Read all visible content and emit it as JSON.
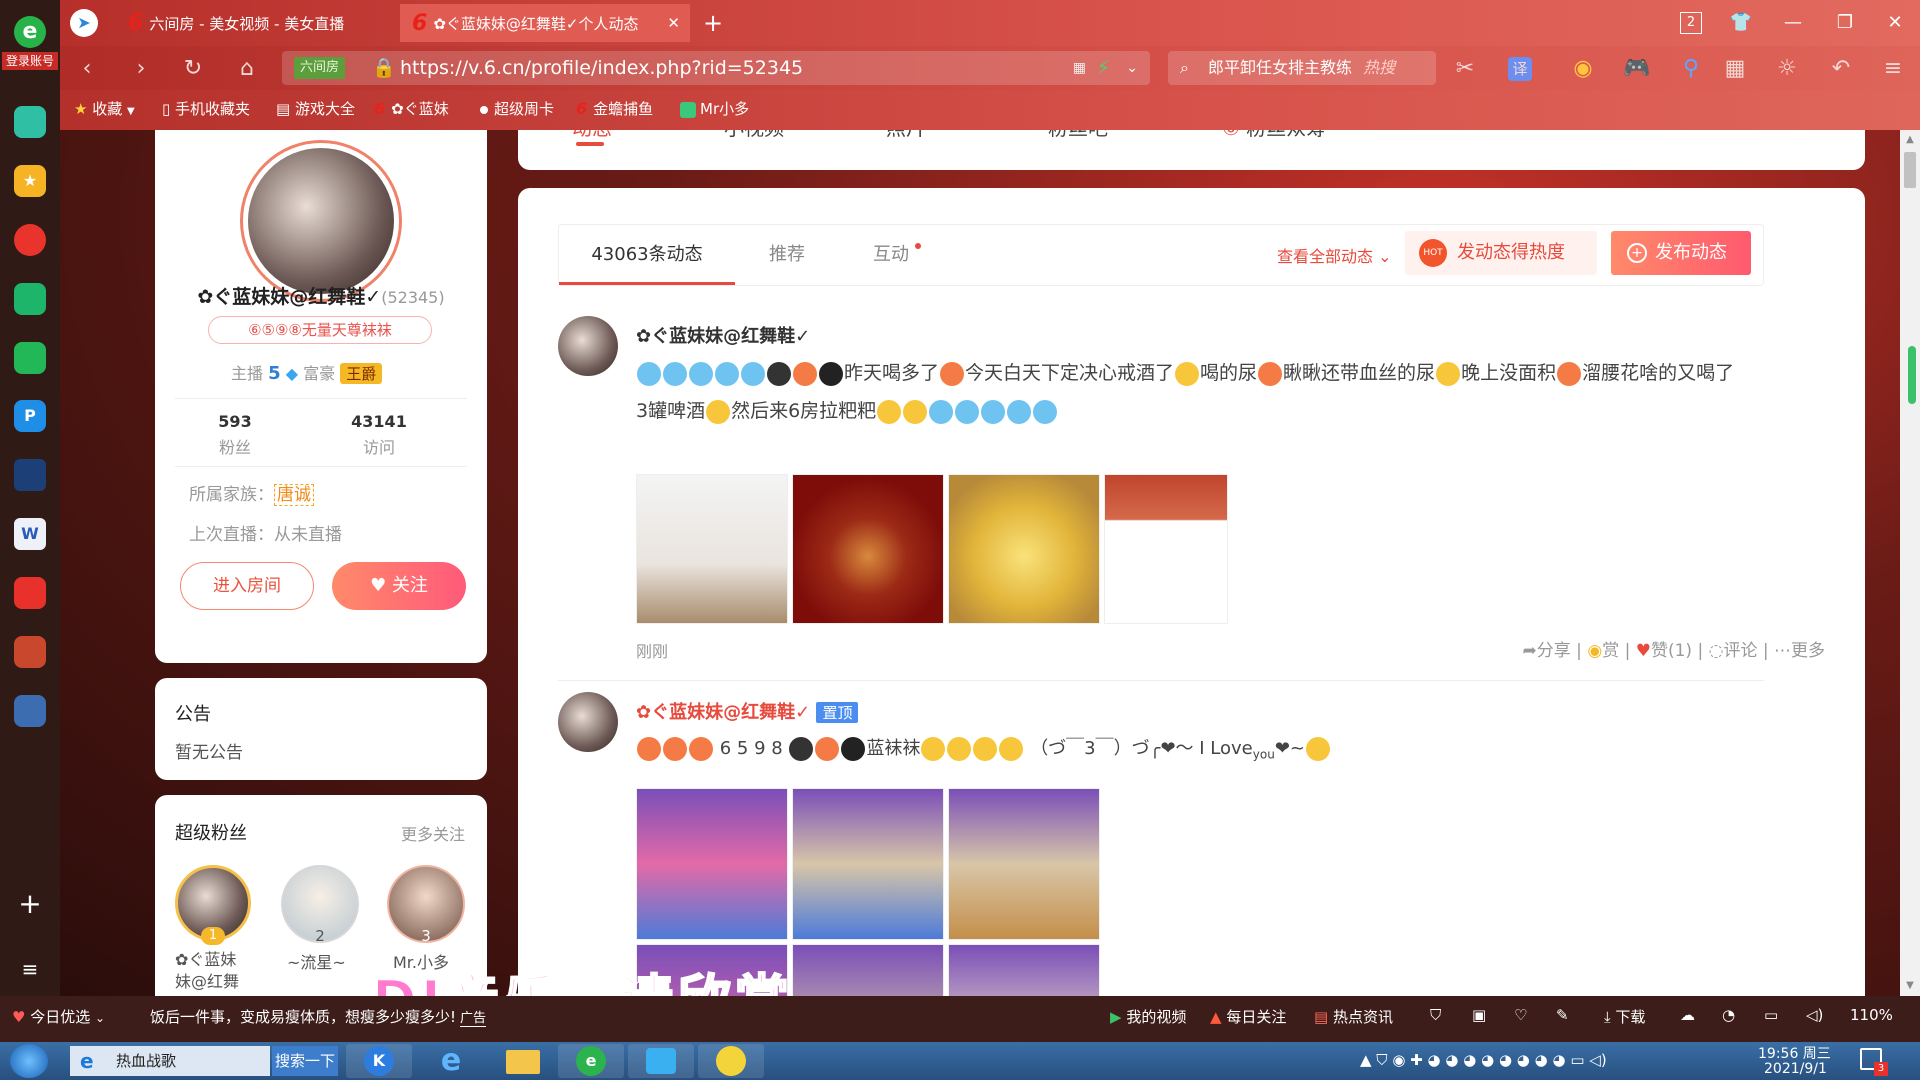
{
  "left_sidebar": {
    "login": "登录账号"
  },
  "tabs": [
    {
      "label": "六间房 - 美女视频 - 美女直播",
      "active": false
    },
    {
      "label": "✿ぐ蓝妹妹@红舞鞋✓个人动态",
      "active": true
    }
  ],
  "tab_counter": "2",
  "address": {
    "url": "https://v.6.cn/profile/index.php?rid=52345",
    "badge": "六间房"
  },
  "search": {
    "placeholder": "郎平卸任女排主教练",
    "hot": "热搜"
  },
  "bookmarks": [
    "收藏",
    "手机收藏夹",
    "游戏大全",
    "✿ぐ蓝妹",
    "超级周卡",
    "金蟾捕鱼",
    "Mr小多"
  ],
  "profile_tabs": [
    "动态",
    "小视频",
    "照片",
    "粉丝吧",
    "粉丝众筹"
  ],
  "profile": {
    "name": "✿ぐ蓝妹妹@红舞鞋✓",
    "rid": "(52345)",
    "family_tag": "⑥⑤⑨⑧无量天尊袜袜",
    "anchor_label": "主播",
    "anchor_level": "5",
    "rich_label": "富豪",
    "rich_badge": "王爵",
    "fans_count": "593",
    "fans_label": "粉丝",
    "visits_count": "43141",
    "visits_label": "访问",
    "family_label": "所属家族：",
    "family_value": "唐诚",
    "last_live": "上次直播：从未直播",
    "enter_room": "进入房间",
    "follow": "关注"
  },
  "notice": {
    "title": "公告",
    "content": "暂无公告"
  },
  "superfans": {
    "title": "超级粉丝",
    "more": "更多关注",
    "fans": [
      {
        "rank": "1",
        "name": "✿ぐ蓝妹\n妹@红舞"
      },
      {
        "rank": "2",
        "name": "~流星~"
      },
      {
        "rank": "3",
        "name": "Mr.小多"
      }
    ]
  },
  "feed": {
    "tabs": [
      "43063条动态",
      "推荐",
      "互动"
    ],
    "view_all": "查看全部动态",
    "boost": "发动态得热度",
    "publish": "发布动态",
    "posts": [
      {
        "author": "✿ぐ蓝妹妹@红舞鞋✓",
        "text1": "昨天喝多了",
        "text2": "今天白天下定决心戒酒了",
        "text3": "喝的尿",
        "text4": "瞅瞅还带血丝的尿",
        "text5": "晚上没面积",
        "text6": "溜腰花啥",
        "text7": "的又喝了3罐啤酒",
        "text8": "然后来6房拉粑粑",
        "time": "刚刚",
        "share": "分享",
        "reward": "赏",
        "like": "赞(1)",
        "comment": "评论",
        "more": "更多"
      },
      {
        "author": "✿ぐ蓝妹妹@红舞鞋✓",
        "pinned": "置顶",
        "text": "6  5  9  8",
        "text2": "蓝袜袜",
        "text3": "（づ￣3￣）づ╭❤～ I Love",
        "text3b": "you",
        "text4": "❤~"
      }
    ]
  },
  "subtitle": "DJ音乐，请欣赏",
  "statusbar": {
    "today": "今日优选",
    "news": "饭后一件事，变成易瘦体质，想瘦多少瘦多少!",
    "ad": "广告",
    "my_video": "我的视频",
    "daily": "每日关注",
    "hot_news": "热点资讯",
    "download": "下载",
    "zoom": "110%"
  },
  "taskbar": {
    "ie_label": "热血战歌",
    "search_btn": "搜索一下",
    "time": "19:56 周三",
    "date": "2021/9/1",
    "notif": "3"
  }
}
